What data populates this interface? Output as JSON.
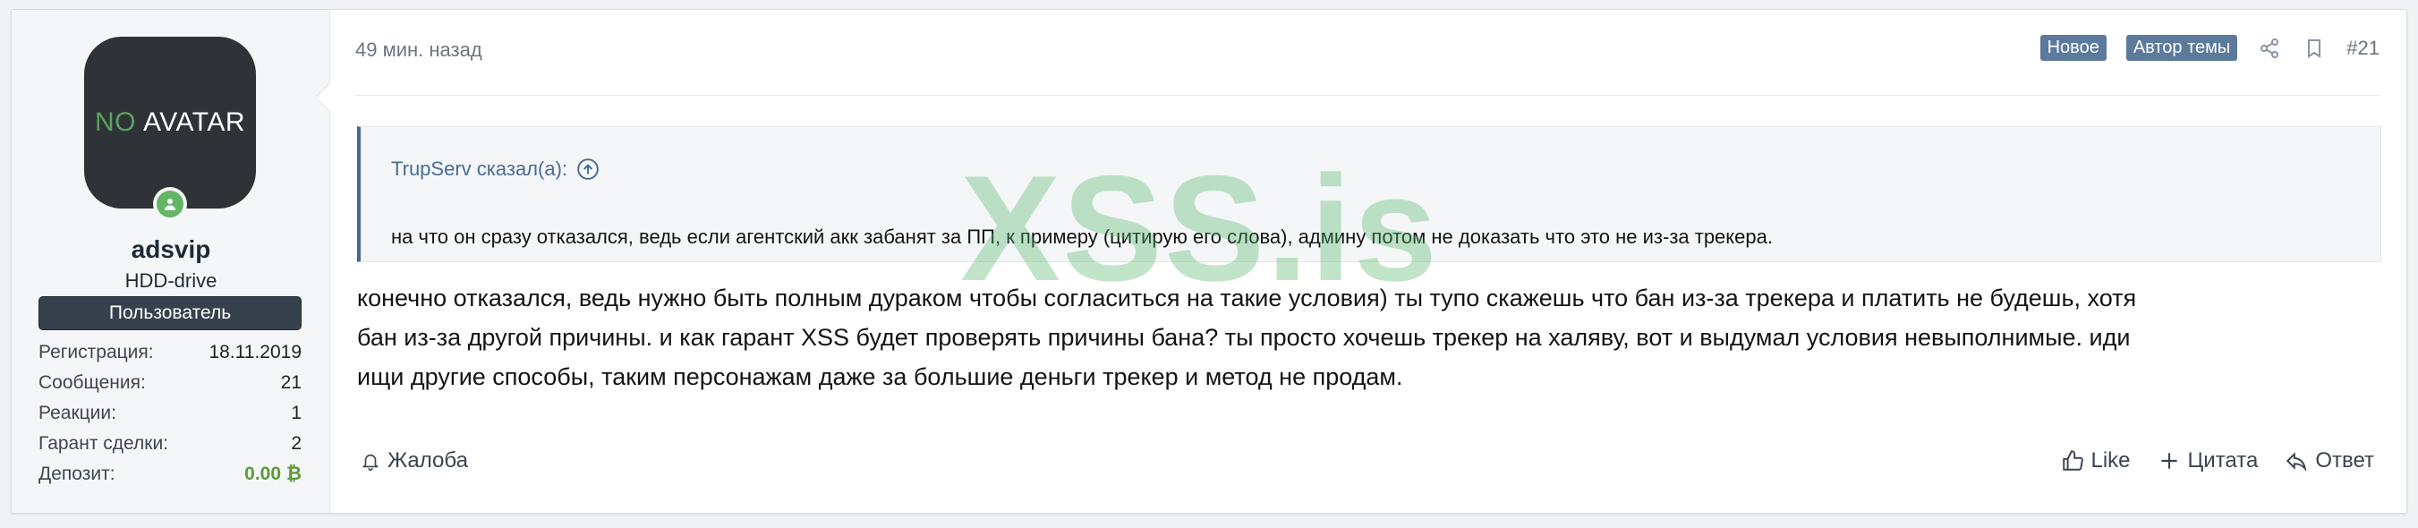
{
  "user": {
    "avatar_text_no": "NO",
    "avatar_text_avatar": "AVATAR",
    "username": "adsvip",
    "title": "HDD-drive",
    "banner": "Пользователь",
    "stats": [
      {
        "label": "Регистрация:",
        "value": "18.11.2019"
      },
      {
        "label": "Сообщения:",
        "value": "21"
      },
      {
        "label": "Реакции:",
        "value": "1"
      },
      {
        "label": "Гарант сделки:",
        "value": "2"
      },
      {
        "label": "Депозит:",
        "value": "0.00 ₿"
      }
    ]
  },
  "post": {
    "time": "49 мин. назад",
    "tags": [
      "Новое",
      "Автор темы"
    ],
    "number": "#21",
    "quote_author": "TrupServ сказал(а):",
    "quote_text": "на что он сразу отказался, ведь если агентский акк забанят за ПП, к примеру (цитирую его слова), админу потом не доказать что это не из-за трекера.",
    "body_lines": [
      "конечно отказался, ведь нужно быть полным дураком чтобы согласиться на такие условия) ты тупо скажешь что бан из-за трекера и платить не будешь, хотя",
      "бан из-за другой причины. и как гарант XSS будет проверять причины бана? ты просто хочешь трекер на халяву, вот и выдумал условия невыполнимые. иди",
      "ищи другие способы, таким персонажам даже за большие деньги трекер и метод не продам."
    ]
  },
  "actions": {
    "report": "Жалоба",
    "like": "Like",
    "quote": "Цитата",
    "reply": "Ответ"
  },
  "watermark": "XSS.is",
  "colors": {
    "tag_bg": "#5b7a9c",
    "quote_border": "#45698f",
    "online": "#63b665",
    "deposit": "#5c9a3a"
  }
}
